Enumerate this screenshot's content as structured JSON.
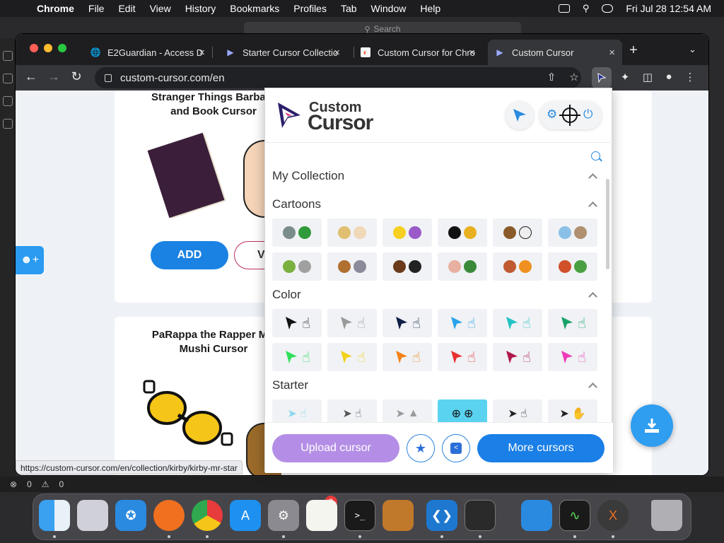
{
  "menubar": {
    "app": "Chrome",
    "items": [
      "File",
      "Edit",
      "View",
      "History",
      "Bookmarks",
      "Profiles",
      "Tab",
      "Window",
      "Help"
    ],
    "clock": "Fri Jul 28  12:54 AM"
  },
  "background_editor": {
    "search_placeholder": "Search",
    "status_errors": "0",
    "status_warnings": "0"
  },
  "chrome": {
    "tabs": [
      {
        "label": "E2Guardian - Access D",
        "icon": "globe-icon"
      },
      {
        "label": "Starter Cursor Collectio",
        "icon": "cursor-icon"
      },
      {
        "label": "Custom Cursor for Chro",
        "icon": "rainbow-icon"
      },
      {
        "label": "Custom Cursor",
        "icon": "cursor-icon"
      }
    ],
    "url": "custom-cursor.com/en",
    "status_link": "https://custom-cursor.com/en/collection/kirby/kirby-mr-star"
  },
  "page": {
    "card1_title": "Stranger Things Barbara\nand Book Cursor",
    "add_label": "ADD",
    "view_label": "V",
    "card2_title": "PaRappa the Rapper MC\nMushi Cursor"
  },
  "popup": {
    "logo_line1": "Custom",
    "logo_line2": "Cursor",
    "sections": [
      {
        "title": "My Collection"
      },
      {
        "title": "Cartoons"
      },
      {
        "title": "Color"
      },
      {
        "title": "Starter"
      }
    ],
    "upload_label": "Upload cursor",
    "more_label": "More cursors"
  },
  "colors": {
    "accent_blue": "#1a82e2",
    "upload_purple": "#b48ee6",
    "selected_cyan": "#5ad3f0",
    "color_cursor_pairs": [
      "#111111",
      "#9a9a9a",
      "#0e1e45",
      "#2aa3e8",
      "#22c4c4",
      "#17a36a",
      "#2fe05c",
      "#f2d21a",
      "#f2821a",
      "#e83030",
      "#b0184a",
      "#f03ab8"
    ]
  },
  "dock": {
    "apps": [
      "Finder",
      "Launchpad",
      "Safari",
      "Firefox",
      "Chrome",
      "App Store",
      "System Settings",
      "TextEdit",
      "Terminal",
      "GarageBand",
      "VS Code",
      "Script Editor",
      "Keynote",
      "Activity Monitor",
      "X11",
      "Trash"
    ],
    "settings_badge": "2"
  }
}
